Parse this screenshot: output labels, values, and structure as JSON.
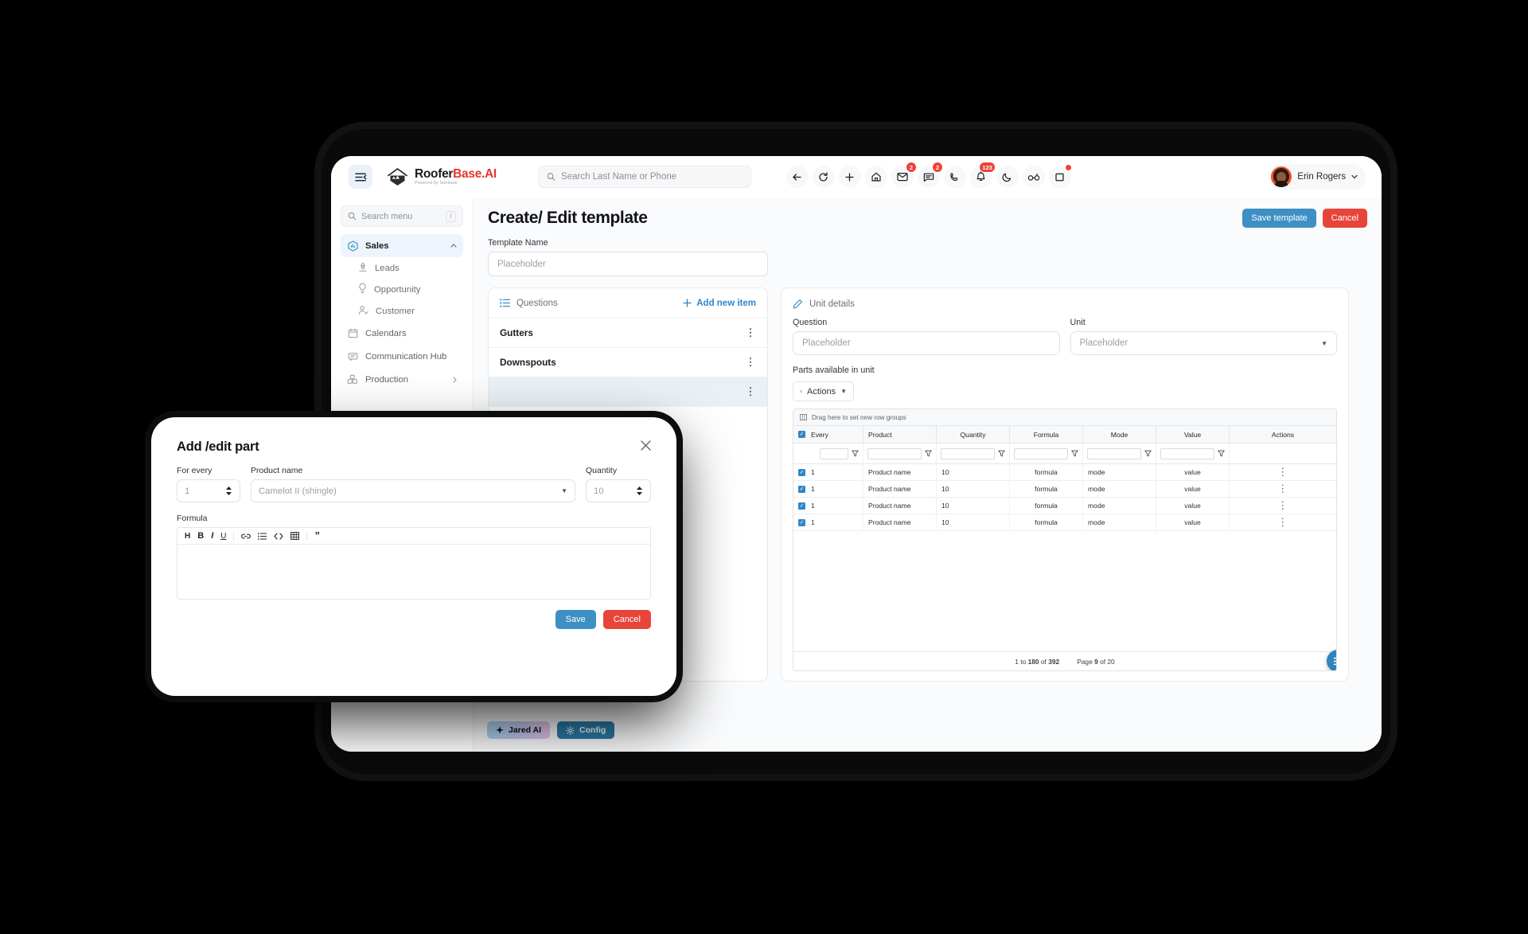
{
  "brand": {
    "name_dark": "Roofer",
    "name_red": "Base.AI",
    "tagline": "Powered by Sunbase"
  },
  "topbar": {
    "search_placeholder": "Search Last Name or Phone",
    "icons": [
      {
        "name": "back-icon",
        "badge": ""
      },
      {
        "name": "refresh-icon",
        "badge": ""
      },
      {
        "name": "plus-icon",
        "badge": ""
      },
      {
        "name": "home-icon",
        "badge": ""
      },
      {
        "name": "mail-icon",
        "badge": "2"
      },
      {
        "name": "chat-icon",
        "badge": "2"
      },
      {
        "name": "phone-icon",
        "badge": ""
      },
      {
        "name": "bell-icon",
        "badge": "123"
      },
      {
        "name": "moon-icon",
        "badge": ""
      },
      {
        "name": "glasses-icon",
        "badge": ""
      },
      {
        "name": "window-icon",
        "badge": "dot"
      }
    ],
    "user_name": "Erin Rogers"
  },
  "sidebar": {
    "search_placeholder": "Search menu",
    "search_shortcut": "/",
    "items": [
      {
        "label": "Sales",
        "icon": "sales-icon",
        "active": true,
        "expanded": true
      },
      {
        "label": "Leads",
        "icon": "leads-icon",
        "sub": true
      },
      {
        "label": "Opportunity",
        "icon": "opportunity-icon",
        "sub": true
      },
      {
        "label": "Customer",
        "icon": "customer-icon",
        "sub": true
      },
      {
        "label": "Calendars",
        "icon": "calendar-icon"
      },
      {
        "label": "Communication Hub",
        "icon": "communication-icon"
      },
      {
        "label": "Production",
        "icon": "production-icon",
        "chevron": true
      }
    ]
  },
  "page": {
    "title": "Create/ Edit template",
    "save_label": "Save template",
    "cancel_label": "Cancel",
    "template_name_label": "Template Name",
    "template_name_placeholder": "Placeholder"
  },
  "questions_pane": {
    "header": "Questions",
    "add_label": "Add new item",
    "items": [
      {
        "label": "Gutters",
        "selected": false
      },
      {
        "label": "Downspouts",
        "selected": false
      },
      {
        "label": "",
        "selected": true
      }
    ]
  },
  "unit_pane": {
    "header": "Unit details",
    "question_label": "Question",
    "question_placeholder": "Placeholder",
    "unit_label": "Unit",
    "unit_placeholder": "Placeholder",
    "parts_label": "Parts available in unit",
    "actions_label": "Actions",
    "grid": {
      "drag_hint": "Drag here to set new row groups",
      "columns": [
        "Every",
        "Product",
        "Quantity",
        "Formula",
        "Mode",
        "Value",
        "Actions"
      ],
      "rows": [
        {
          "every": "1",
          "product": "Product name",
          "quantity": "10",
          "formula": "formula",
          "mode": "mode",
          "value": "value",
          "checked": true
        },
        {
          "every": "1",
          "product": "Product name",
          "quantity": "10",
          "formula": "formula",
          "mode": "mode",
          "value": "value",
          "checked": true
        },
        {
          "every": "1",
          "product": "Product name",
          "quantity": "10",
          "formula": "formula",
          "mode": "mode",
          "value": "value",
          "checked": true
        },
        {
          "every": "1",
          "product": "Product name",
          "quantity": "10",
          "formula": "formula",
          "mode": "mode",
          "value": "value",
          "checked": true
        }
      ],
      "footer_range_prefix": "1 to ",
      "footer_range_bold": "180",
      "footer_range_mid": " of ",
      "footer_total": "392",
      "footer_page_prefix": "Page ",
      "footer_page": "9",
      "footer_page_suffix": " of 20",
      "footer_text": "1 to 180 of 392",
      "footer_page_text": "Page 9 of 20"
    }
  },
  "chips": [
    {
      "label": "Jared AI",
      "icon": "sparkle-icon"
    },
    {
      "label": "Config",
      "icon": "gear-icon"
    }
  ],
  "modal": {
    "title": "Add /edit part",
    "for_every_label": "For every",
    "for_every_value": "1",
    "product_label": "Product name",
    "product_value": "Camelot II (shingle)",
    "quantity_label": "Quantity",
    "quantity_value": "10",
    "formula_label": "Formula",
    "toolbar": [
      "H",
      "B",
      "I",
      "U",
      "link-icon",
      "list-icon",
      "code-icon",
      "table-icon",
      "quote-icon"
    ],
    "formula_value": "",
    "save_label": "Save",
    "cancel_label": "Cancel"
  },
  "colors": {
    "accent_blue": "#3d8fc4",
    "danger_red": "#e8453a",
    "link_blue": "#2f86c9",
    "brand_red": "#e8352a",
    "badge_red": "#ef4136"
  }
}
